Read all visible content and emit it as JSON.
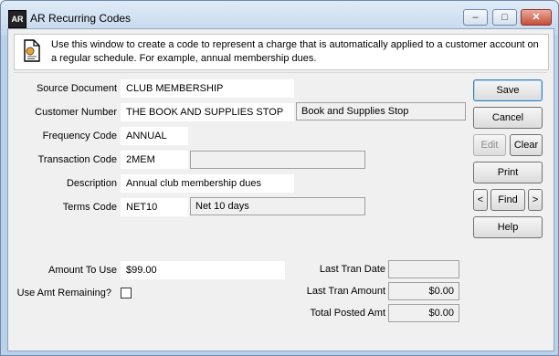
{
  "window": {
    "title": "AR Recurring Codes",
    "app_icon_text": "AR",
    "controls": {
      "minimize": "‒",
      "maximize": "□",
      "close": "✕"
    }
  },
  "info": {
    "icon": "document-icon",
    "text": "Use this window to create a code to represent a charge that is automatically applied to a customer account on a regular schedule.  For example, annual membership dues."
  },
  "form": {
    "source_document": {
      "label": "Source Document",
      "value": "CLUB MEMBERSHIP"
    },
    "customer_number": {
      "label": "Customer Number",
      "value": "THE BOOK AND SUPPLIES STOP",
      "name": "Book and Supplies Stop"
    },
    "frequency_code": {
      "label": "Frequency Code",
      "value": "ANNUAL"
    },
    "transaction_code": {
      "label": "Transaction Code",
      "value": "2MEM",
      "description": ""
    },
    "description": {
      "label": "Description",
      "value": "Annual club membership dues"
    },
    "terms_code": {
      "label": "Terms Code",
      "value": "NET10",
      "description": "Net 10 days"
    },
    "amount_to_use": {
      "label": "Amount To Use",
      "value": "$99.00"
    },
    "use_amt_remaining": {
      "label": "Use Amt Remaining?",
      "checked": false
    },
    "last_tran_date": {
      "label": "Last Tran Date",
      "value": ""
    },
    "last_tran_amount": {
      "label": "Last Tran Amount",
      "value": "$0.00"
    },
    "total_posted_amt": {
      "label": "Total Posted Amt",
      "value": "$0.00"
    }
  },
  "buttons": {
    "save": "Save",
    "cancel": "Cancel",
    "edit": "Edit",
    "clear": "Clear",
    "print": "Print",
    "prev": "<",
    "find": "Find",
    "next": ">",
    "help": "Help"
  }
}
